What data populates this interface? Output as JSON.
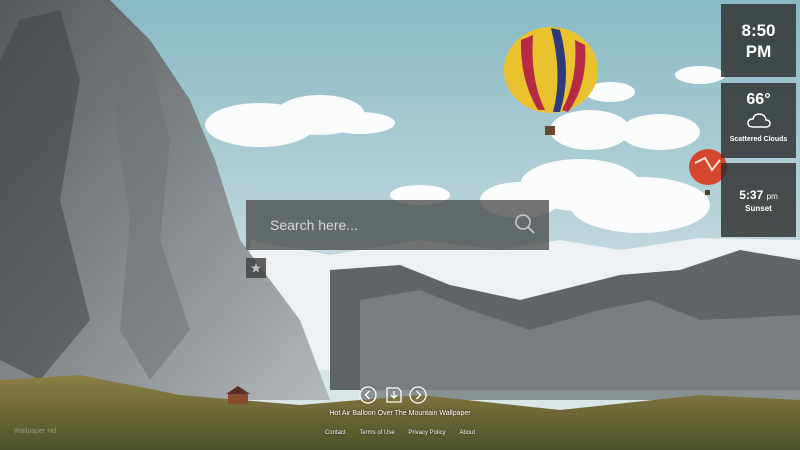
{
  "search": {
    "placeholder": "Search here..."
  },
  "clock": {
    "hour_minute": "8:50",
    "meridiem": "PM"
  },
  "weather": {
    "temperature": "66°",
    "condition": "Scattered Clouds",
    "icon": "cloud-icon"
  },
  "sunset": {
    "time": "5:37",
    "meridiem": "pm",
    "label": "Sunset"
  },
  "wallpaper": {
    "title": "Hot Air Balloon Over The Mountain Wallpaper"
  },
  "footer": {
    "links": [
      "Contact",
      "Terms of Use",
      "Privacy Policy",
      "About"
    ]
  },
  "watermark": "Wallpaper Hd",
  "colors": {
    "widget_bg": "#2d2d2d",
    "search_bg": "#464646",
    "sky": "#a9cad3"
  }
}
